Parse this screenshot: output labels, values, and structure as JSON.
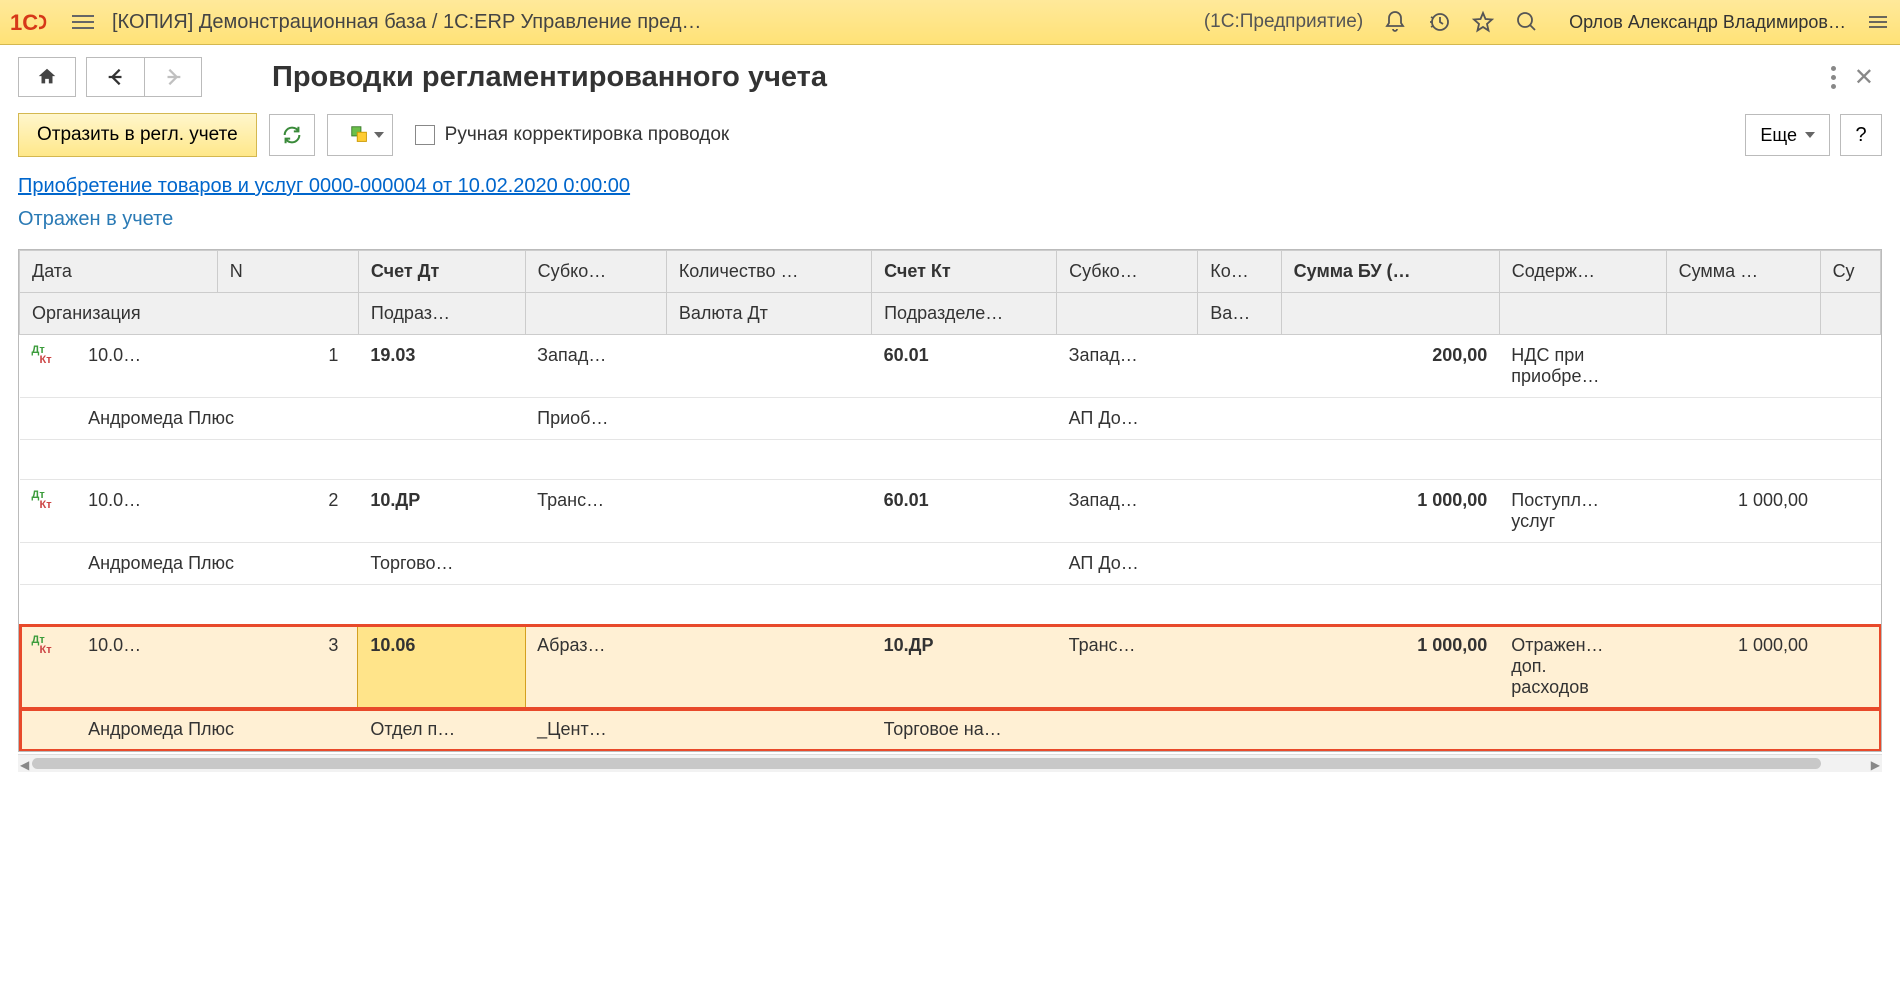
{
  "titlebar": {
    "title": "[КОПИЯ] Демонстрационная база / 1С:ERP Управление пред…",
    "mode": "(1С:Предприятие)",
    "user": "Орлов Александр Владимиров…"
  },
  "page": {
    "title": "Проводки регламентированного учета",
    "main_button": "Отразить в регл. учете",
    "manual_checkbox": "Ручная корректировка проводок",
    "more": "Еще",
    "help": "?",
    "doc_link": "Приобретение товаров и услуг 0000-000004 от 10.02.2020 0:00:00",
    "status": "Отражен в учете"
  },
  "headers": {
    "r1": {
      "date": "Дата",
      "n": "N",
      "acc_dt": "Счет Дт",
      "sub_dt": "Субко…",
      "qty": "Количество …",
      "acc_kt": "Счет Кт",
      "sub_kt": "Субко…",
      "qty_kt": "Ко…",
      "sum_bu": "Сумма БУ (…",
      "desc": "Содерж…",
      "sum": "Сумма …",
      "last": "Су"
    },
    "r2": {
      "org": "Организация",
      "dept_dt": "Подраз…",
      "curr_dt": "Валюта Дт",
      "dept_kt": "Подразделе…",
      "curr_kt": "Ва…"
    }
  },
  "rows": [
    {
      "date": "10.0…",
      "n": "1",
      "acc_dt": "19.03",
      "sub_dt": "Запад…",
      "qty": "",
      "acc_kt": "60.01",
      "sub_kt": "Запад…",
      "qty_kt": "",
      "sum_bu": "200,00",
      "desc1": "НДС при",
      "desc2": "приобре…",
      "sum": "",
      "org": "Андромеда Плюс",
      "dept_dt": "",
      "sub_dt2": "Приоб…",
      "curr_dt": "",
      "dept_kt": "",
      "sub_kt2": "АП До…",
      "curr_kt": ""
    },
    {
      "date": "10.0…",
      "n": "2",
      "acc_dt": "10.ДР",
      "sub_dt": "Транс…",
      "qty": "",
      "acc_kt": "60.01",
      "sub_kt": "Запад…",
      "qty_kt": "",
      "sum_bu": "1 000,00",
      "desc1": "Поступл…",
      "desc2": "услуг",
      "sum": "1 000,00",
      "org": "Андромеда Плюс",
      "dept_dt": "Торгово…",
      "sub_dt2": "",
      "curr_dt": "",
      "dept_kt": "",
      "sub_kt2": "АП До…",
      "curr_kt": ""
    },
    {
      "date": "10.0…",
      "n": "3",
      "acc_dt": "10.06",
      "sub_dt": "Абраз…",
      "qty": "",
      "acc_kt": "10.ДР",
      "sub_kt": "Транс…",
      "qty_kt": "",
      "sum_bu": "1 000,00",
      "desc1": "Отражен…",
      "desc2": "доп.",
      "desc3": "расходов",
      "sum": "1 000,00",
      "org": "Андромеда Плюс",
      "dept_dt": "Отдел п…",
      "sub_dt2": "_Цент…",
      "curr_dt": "",
      "dept_kt": "Торговое на…",
      "sub_kt2": "",
      "curr_kt": ""
    }
  ]
}
